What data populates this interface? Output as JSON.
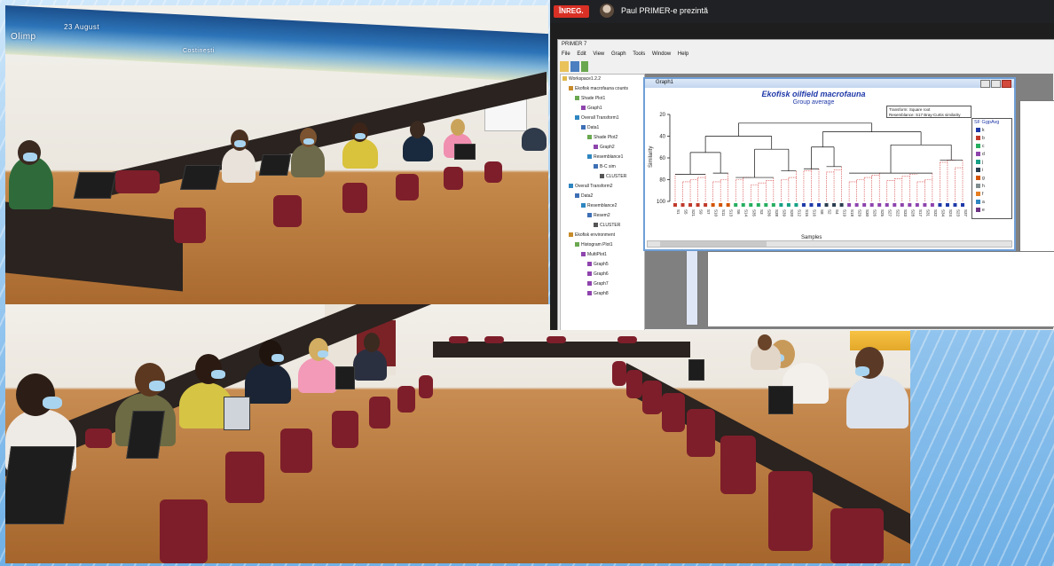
{
  "background": {
    "style": "blue-wave"
  },
  "top_photo": {
    "map_labels": [
      "Olimp",
      "23 August",
      "Costinești"
    ]
  },
  "presenter_bar": {
    "rec_label": "ÎNREG.",
    "presenter_text": "Paul PRIMER-e prezintă",
    "rec_color": "#d93025"
  },
  "primer_window": {
    "title": "PRIMER 7",
    "menu": [
      "File",
      "Edit",
      "View",
      "Graph",
      "Tools",
      "Window",
      "Help"
    ],
    "tree": [
      "Workspace1.2.2",
      "Ekofisk macrofauna counts",
      "Shade Plot1",
      "Graph1",
      "Overall Transform1",
      "Data1",
      "Shade Plot2",
      "Graph2",
      "Resemblance1",
      "B-C sim",
      "CLUSTER",
      "Overall Transform2",
      "Data2",
      "Resemblance2",
      "Resem2",
      "CLUSTER",
      "Ekofisk environment",
      "Histogram Plot1",
      "MultiPlot1",
      "Graph5",
      "Graph6",
      "Graph7",
      "Graph8"
    ],
    "graph_window": {
      "title": "Graph1",
      "chart_title": "Ekofisk oilfield macrofauna",
      "chart_subtitle": "Group average",
      "info_lines": [
        "Transform: Square root",
        "Resemblance: S17 Bray-Curtis similarity"
      ],
      "legend_title": "SF GgpAvg",
      "legend_items": [
        {
          "label": "k",
          "color": "#1f39a8"
        },
        {
          "label": "b",
          "color": "#c0392b"
        },
        {
          "label": "c",
          "color": "#27ae60"
        },
        {
          "label": "d",
          "color": "#8e44ad"
        },
        {
          "label": "j",
          "color": "#16a085"
        },
        {
          "label": "i",
          "color": "#2c3e50"
        },
        {
          "label": "g",
          "color": "#d35400"
        },
        {
          "label": "h",
          "color": "#7f8c8d"
        },
        {
          "label": "f",
          "color": "#e67e22"
        },
        {
          "label": "a",
          "color": "#2e86c1"
        },
        {
          "label": "e",
          "color": "#6c3483"
        }
      ],
      "y_label": "Similarity",
      "x_label": "Samples",
      "y_ticks": [
        "20",
        "40",
        "60",
        "80",
        "100"
      ],
      "samples": [
        "S1",
        "S5",
        "S21",
        "S9",
        "S7",
        "S10",
        "S11",
        "S13",
        "S6",
        "S14",
        "S35",
        "S3",
        "S36",
        "S38",
        "S39",
        "S20",
        "S12",
        "S15",
        "S16",
        "S8",
        "S2",
        "S4",
        "S19",
        "S18",
        "S29",
        "S30",
        "S26",
        "S25",
        "S27",
        "S22",
        "S33",
        "S28",
        "S17",
        "S31",
        "S32",
        "S34",
        "S24",
        "S23",
        "S37"
      ],
      "sample_colors": [
        "#c0392b",
        "#c0392b",
        "#c0392b",
        "#c0392b",
        "#c0392b",
        "#d35400",
        "#d35400",
        "#d35400",
        "#27ae60",
        "#27ae60",
        "#27ae60",
        "#27ae60",
        "#27ae60",
        "#27ae60",
        "#16a085",
        "#16a085",
        "#16a085",
        "#1f39a8",
        "#1f39a8",
        "#1f39a8",
        "#2c3e50",
        "#2c3e50",
        "#2c3e50",
        "#8e44ad",
        "#8e44ad",
        "#8e44ad",
        "#8e44ad",
        "#8e44ad",
        "#8e44ad",
        "#8e44ad",
        "#8e44ad",
        "#8e44ad",
        "#8e44ad",
        "#8e44ad",
        "#8e44ad",
        "#1f39a8",
        "#1f39a8",
        "#1f39a8",
        "#1f39a8"
      ]
    }
  }
}
